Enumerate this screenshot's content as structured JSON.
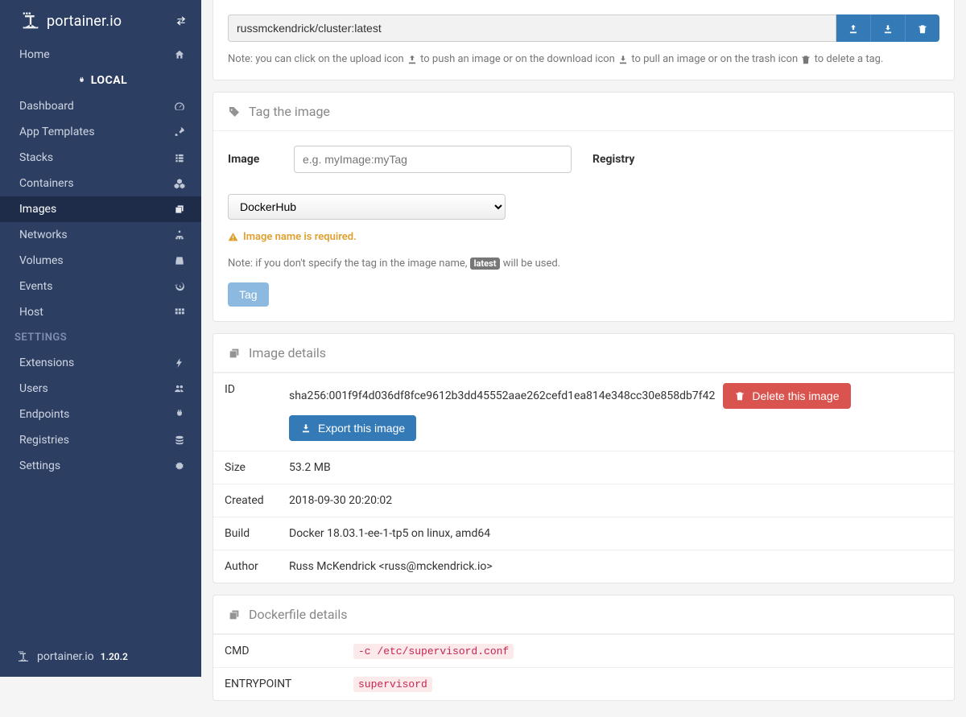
{
  "brand": {
    "name": "portainer.io",
    "version": "1.20.2"
  },
  "sidebar": {
    "home": "Home",
    "endpoint": "LOCAL",
    "items": [
      {
        "label": "Dashboard"
      },
      {
        "label": "App Templates"
      },
      {
        "label": "Stacks"
      },
      {
        "label": "Containers"
      },
      {
        "label": "Images"
      },
      {
        "label": "Networks"
      },
      {
        "label": "Volumes"
      },
      {
        "label": "Events"
      },
      {
        "label": "Host"
      }
    ],
    "settings_heading": "SETTINGS",
    "settings_items": [
      {
        "label": "Extensions"
      },
      {
        "label": "Users"
      },
      {
        "label": "Endpoints"
      },
      {
        "label": "Registries"
      },
      {
        "label": "Settings"
      }
    ]
  },
  "tag_input": {
    "value": "russmckendrick/cluster:latest",
    "note_prefix": "Note: you can click on the upload icon ",
    "note_mid1": " to push an image or on the download icon ",
    "note_mid2": " to pull an image or on the trash icon ",
    "note_suffix": " to delete a tag."
  },
  "tag_panel": {
    "title": "Tag the image",
    "image_label": "Image",
    "image_placeholder": "e.g. myImage:myTag",
    "registry_label": "Registry",
    "registry_value": "DockerHub",
    "warning": "Image name is required.",
    "note_before": "Note: if you don't specify the tag in the image name, ",
    "note_pill": "latest",
    "note_after": " will be used.",
    "tag_btn": "Tag"
  },
  "details": {
    "title": "Image details",
    "id_label": "ID",
    "id_value": "sha256:001f9f4d036df8fce9612b3dd45552aae262cefd1ea814e348cc30e858db7f42",
    "delete_btn": "Delete this image",
    "export_btn": "Export this image",
    "size_label": "Size",
    "size_value": "53.2 MB",
    "created_label": "Created",
    "created_value": "2018-09-30 20:20:02",
    "build_label": "Build",
    "build_value": "Docker 18.03.1-ee-1-tp5 on linux, amd64",
    "author_label": "Author",
    "author_value": "Russ McKendrick <russ@mckendrick.io>"
  },
  "dockerfile": {
    "title": "Dockerfile details",
    "cmd_label": "CMD",
    "cmd_value": "-c /etc/supervisord.conf",
    "entry_label": "ENTRYPOINT",
    "entry_value": "supervisord"
  }
}
